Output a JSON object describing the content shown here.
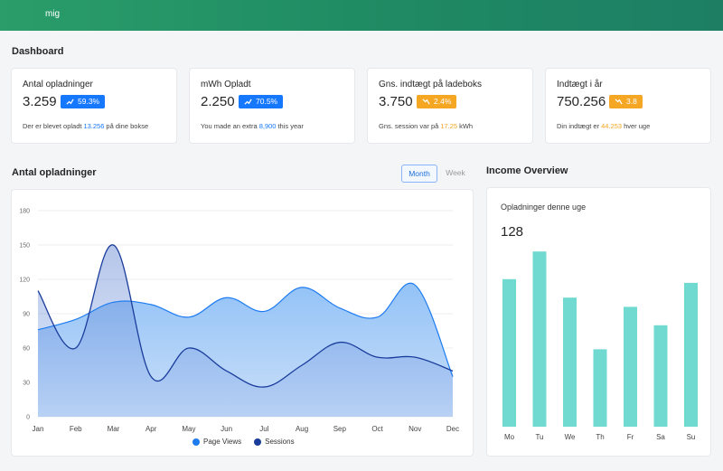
{
  "topbar": {
    "brand": "mig"
  },
  "page_title": "Dashboard",
  "stats": [
    {
      "label": "Antal opladninger",
      "value": "3.259",
      "badge": "59.3%",
      "trend": "up",
      "color": "#1677ff",
      "foot_pre": "Der er blevet opladt",
      "foot_hl": "13.256",
      "foot_post": "på dine bokse",
      "hl_color": "#1677ff"
    },
    {
      "label": "mWh Opladt",
      "value": "2.250",
      "badge": "70.5%",
      "trend": "up",
      "color": "#1677ff",
      "foot_pre": "You made an extra",
      "foot_hl": "8,900",
      "foot_post": "this year",
      "hl_color": "#1677ff"
    },
    {
      "label": "Gns. indtægt på ladeboks",
      "value": "3.750",
      "badge": "2.4%",
      "trend": "down",
      "color": "#f5a623",
      "foot_pre": "Gns. session var på",
      "foot_hl": "17.25",
      "foot_post": "kWh",
      "hl_color": "#f5a623"
    },
    {
      "label": "Indtægt i år",
      "value": "750.256",
      "badge": "3.8",
      "trend": "down",
      "color": "#f5a623",
      "foot_pre": "Din indtægt er",
      "foot_hl": "44.253",
      "foot_post": "hver uge",
      "hl_color": "#f5a623"
    }
  ],
  "area_section": {
    "title": "Antal opladninger",
    "toggle_month": "Month",
    "toggle_week": "Week"
  },
  "income_section": {
    "title": "Income Overview",
    "card_label": "Opladninger denne uge",
    "card_value": "128"
  },
  "colors": {
    "page_views": "#1e7cf0",
    "sessions": "#1a3d9c",
    "bars": "#71dad0"
  },
  "chart_data": [
    {
      "type": "area",
      "categories": [
        "Jan",
        "Feb",
        "Mar",
        "Apr",
        "May",
        "Jun",
        "Jul",
        "Aug",
        "Sep",
        "Oct",
        "Nov",
        "Dec"
      ],
      "ylim": [
        0,
        180
      ],
      "yticks": [
        0,
        30,
        60,
        90,
        120,
        150,
        180
      ],
      "grid": true,
      "legend_position": "bottom",
      "series": [
        {
          "name": "Page Views",
          "values": [
            76,
            85,
            100,
            98,
            87,
            104,
            92,
            113,
            95,
            87,
            115,
            35
          ]
        },
        {
          "name": "Sessions",
          "values": [
            110,
            60,
            150,
            35,
            60,
            40,
            26,
            45,
            65,
            52,
            52,
            40
          ]
        }
      ]
    },
    {
      "type": "bar",
      "categories": [
        "Mo",
        "Tu",
        "We",
        "Th",
        "Fr",
        "Sa",
        "Su"
      ],
      "values": [
        80,
        95,
        70,
        42,
        65,
        55,
        78
      ],
      "ylim": [
        0,
        100
      ]
    }
  ]
}
